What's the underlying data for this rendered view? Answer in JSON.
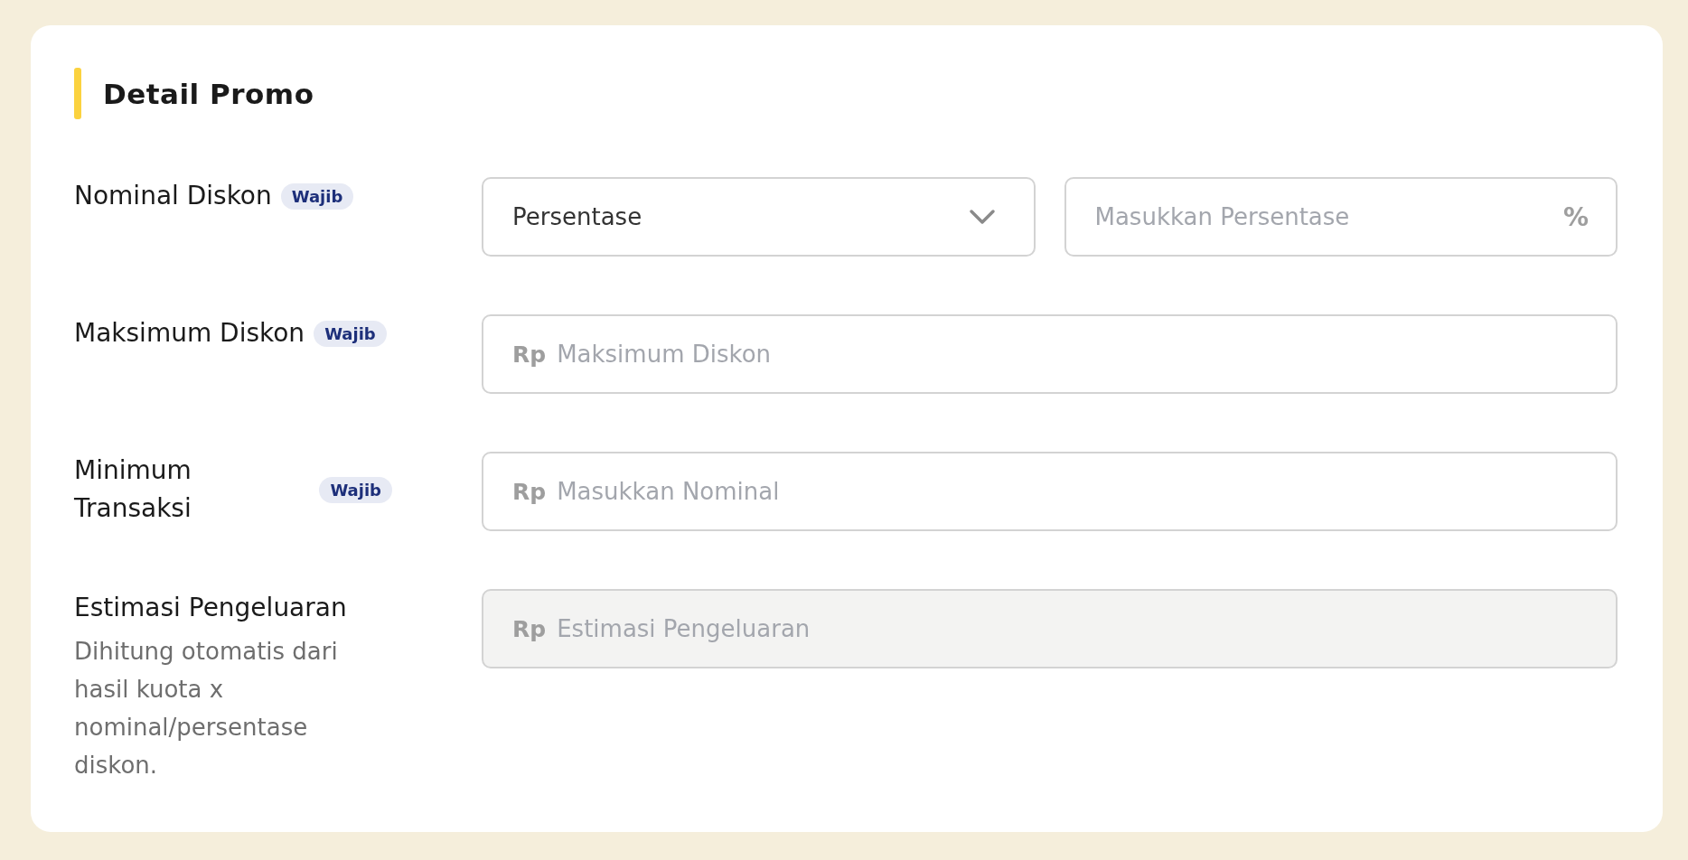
{
  "section": {
    "title": "Detail Promo"
  },
  "fields": [
    {
      "kind": "split",
      "label": "Nominal Diskon",
      "badge": "Wajib",
      "select": {
        "value": "Persentase"
      },
      "input": {
        "placeholder": "Masukkan Persentase",
        "suffix": "%",
        "disabled": false
      }
    },
    {
      "kind": "input",
      "label": "Maksimum Diskon",
      "badge": "Wajib",
      "input": {
        "prefix": "Rp",
        "placeholder": "Maksimum Diskon",
        "disabled": false
      }
    },
    {
      "kind": "input",
      "label": "Minimum Transaksi",
      "badge": "Wajib",
      "input": {
        "prefix": "Rp",
        "placeholder": "Masukkan Nominal",
        "disabled": false
      }
    },
    {
      "kind": "input",
      "label": "Estimasi Pengeluaran",
      "description": "Dihitung otomatis dari hasil kuota x nominal/persentase diskon.",
      "input": {
        "prefix": "Rp",
        "placeholder": "Estimasi Pengeluaran",
        "disabled": true
      }
    }
  ]
}
